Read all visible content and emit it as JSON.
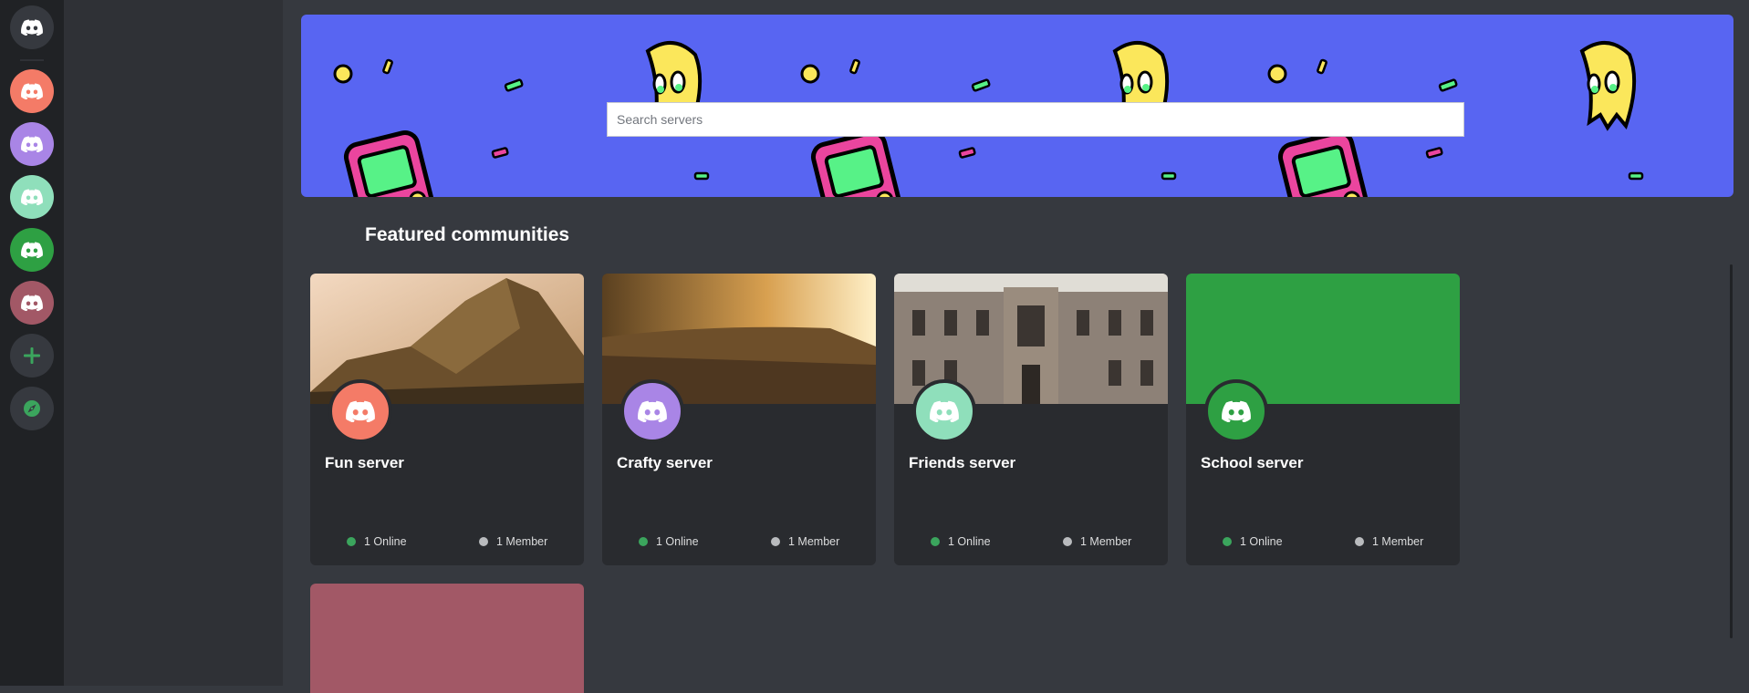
{
  "search": {
    "placeholder": "Search servers"
  },
  "section": {
    "featured_title": "Featured communities"
  },
  "servers": [
    {
      "name": "Fun server",
      "online": "1 Online",
      "members": "1 Member",
      "color": "#f47b67"
    },
    {
      "name": "Crafty server",
      "online": "1 Online",
      "members": "1 Member",
      "color": "#a985e6"
    },
    {
      "name": "Friends server",
      "online": "1 Online",
      "members": "1 Member",
      "color": "#8fdfbb"
    },
    {
      "name": "School server",
      "online": "1 Online",
      "members": "1 Member",
      "color": "#2ea043"
    },
    {
      "name": "",
      "color": "#a25866"
    }
  ],
  "rail": {
    "home_icon": "discord-logo-icon",
    "add_icon": "plus-icon",
    "explore_icon": "compass-icon"
  },
  "colors": {
    "banner": "#5865f2",
    "online": "#3ba55d",
    "member": "#b9bbbe",
    "card_bg": "#292b2f",
    "rail_bg": "#202225"
  }
}
